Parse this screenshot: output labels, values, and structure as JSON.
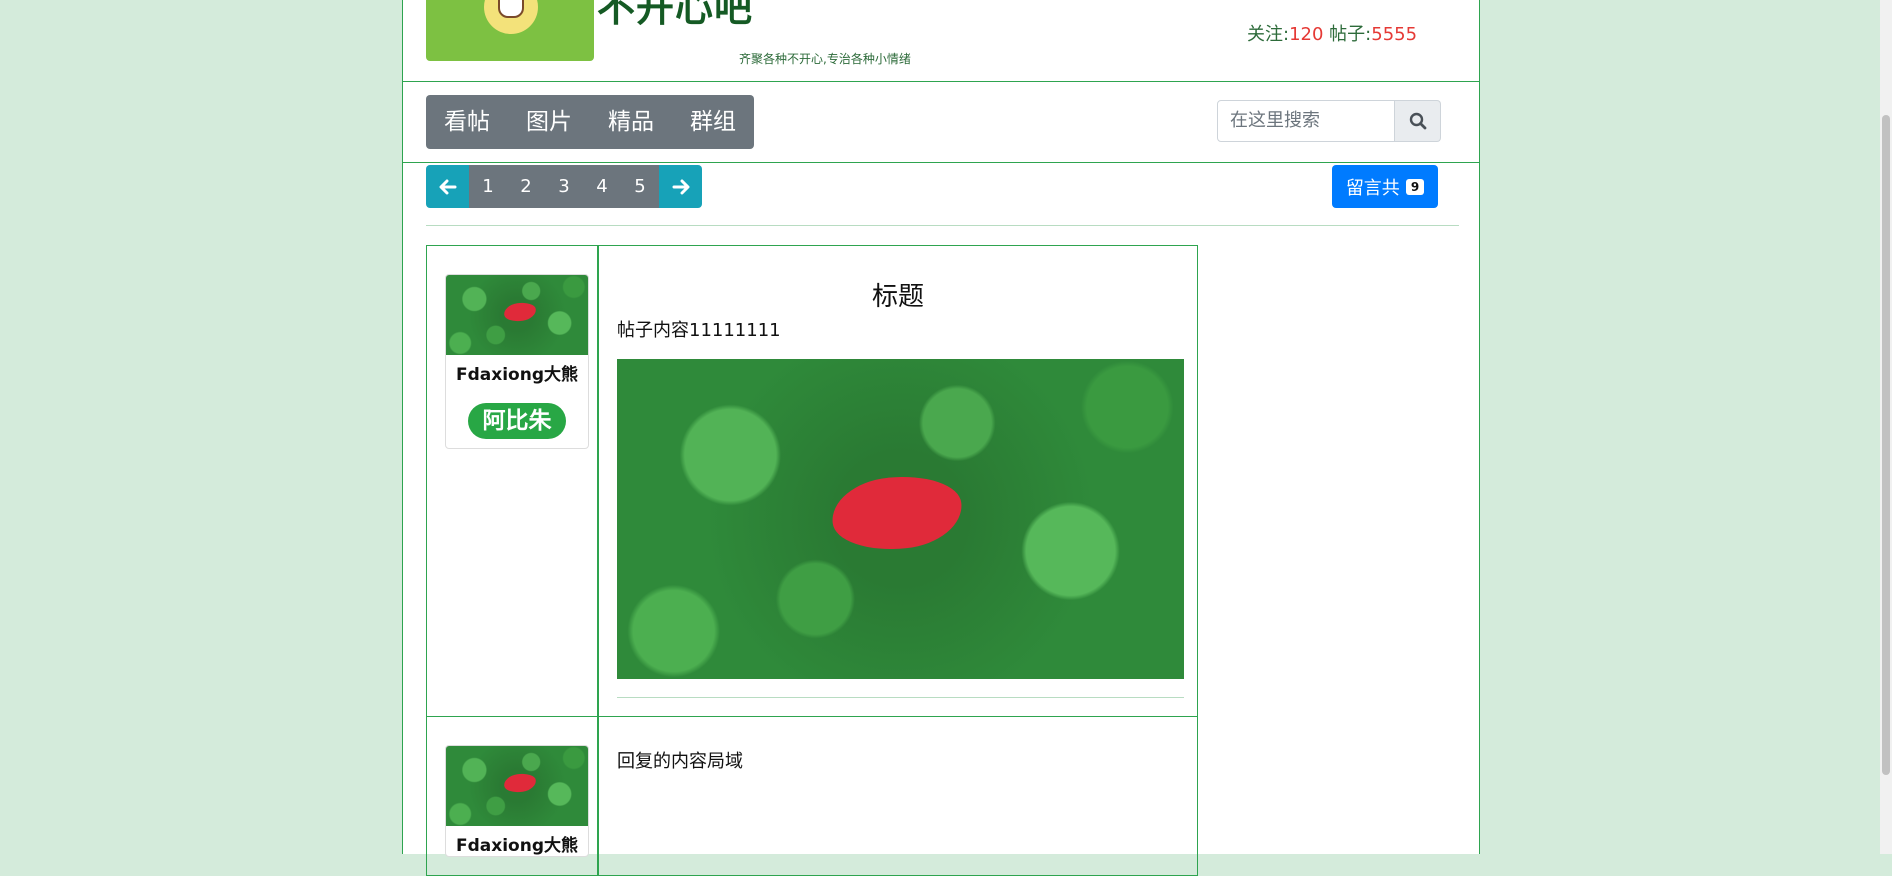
{
  "header": {
    "site_title": "不开心吧",
    "site_subtitle": "齐聚各种不开心,专治各种小情绪",
    "stats_follow_label": "关注:",
    "stats_follow_value": "120",
    "stats_posts_label": "帖子:",
    "stats_posts_value": "5555"
  },
  "nav": {
    "items": [
      {
        "label": "看帖"
      },
      {
        "label": "图片"
      },
      {
        "label": "精品"
      },
      {
        "label": "群组"
      }
    ],
    "search_placeholder": "在这里搜索"
  },
  "pagination": {
    "pages": [
      "1",
      "2",
      "3",
      "4",
      "5"
    ]
  },
  "message_button": {
    "label": "留言共",
    "count": "9"
  },
  "posts": [
    {
      "author": "Fdaxiong大熊",
      "author_tag": "阿比朱",
      "title": "标题",
      "content": "帖子内容11111111"
    },
    {
      "author": "Fdaxiong大熊",
      "content": "回复的内容局域"
    }
  ],
  "colors": {
    "page_bg": "#d4ebdb",
    "accent_green": "#2ea44f",
    "nav_gray": "#6c757d",
    "pager_teal": "#17a2b8",
    "primary_blue": "#007bff",
    "stat_red": "#e53935",
    "tag_green": "#28a745"
  },
  "icons": [
    "search-icon",
    "arrow-left-icon",
    "arrow-right-icon"
  ]
}
